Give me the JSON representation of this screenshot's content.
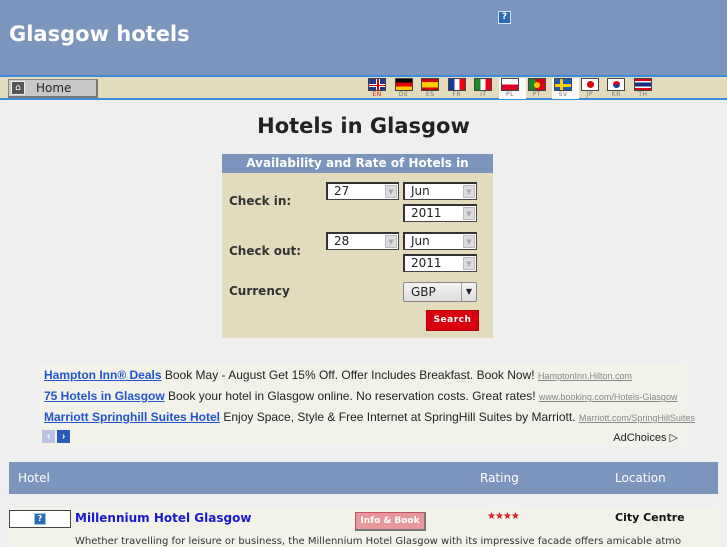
{
  "header": {
    "title": "Glasgow hotels",
    "help_icon": "?"
  },
  "nav": {
    "home_label": "Home",
    "languages": [
      {
        "code": "EN",
        "active": true
      },
      {
        "code": "DE"
      },
      {
        "code": "ES"
      },
      {
        "code": "FR"
      },
      {
        "code": "IT"
      },
      {
        "code": "PL"
      },
      {
        "code": "PT"
      },
      {
        "code": "SV"
      },
      {
        "code": "JP"
      },
      {
        "code": "KR"
      },
      {
        "code": "TH"
      }
    ]
  },
  "main": {
    "page_title": "Hotels in Glasgow"
  },
  "search": {
    "heading": "Availability and Rate of Hotels in",
    "checkin_label": "Check in:",
    "checkin_day": "27",
    "checkin_month": "Jun",
    "checkin_year": "2011",
    "checkout_label": "Check out:",
    "checkout_day": "28",
    "checkout_month": "Jun",
    "checkout_year": "2011",
    "currency_label": "Currency",
    "currency_value": "GBP",
    "search_button": "Search"
  },
  "ads": {
    "items": [
      {
        "title": "Hampton Inn® Deals",
        "text": " Book May - August Get 15% Off. Offer Includes Breakfast. Book Now! ",
        "url": "HamptonInn.Hilton.com"
      },
      {
        "title": "75 Hotels in Glasgow",
        "text": " Book your hotel in Glasgow online. No reservation costs. Great rates! ",
        "url": "www.booking.com/Hotels-Glasgow"
      },
      {
        "title": "Marriott Springhill Suites Hotel",
        "text": " Enjoy Space, Style & Free Internet at SpringHill Suites by Marriott. ",
        "url": "Marriott.com/SpringHillSuites"
      }
    ],
    "adchoices": "AdChoices ▷"
  },
  "table": {
    "headers": {
      "hotel": "Hotel",
      "rating": "Rating",
      "location": "Location"
    },
    "rows": [
      {
        "name": "Millennium Hotel Glasgow",
        "book_label": "Info & Book",
        "stars": "★★★★",
        "rating": 4,
        "location": "City Centre",
        "description": "Whether travelling for leisure or business, the Millennium Hotel Glasgow with its impressive facade offers amicable atmo"
      }
    ]
  }
}
